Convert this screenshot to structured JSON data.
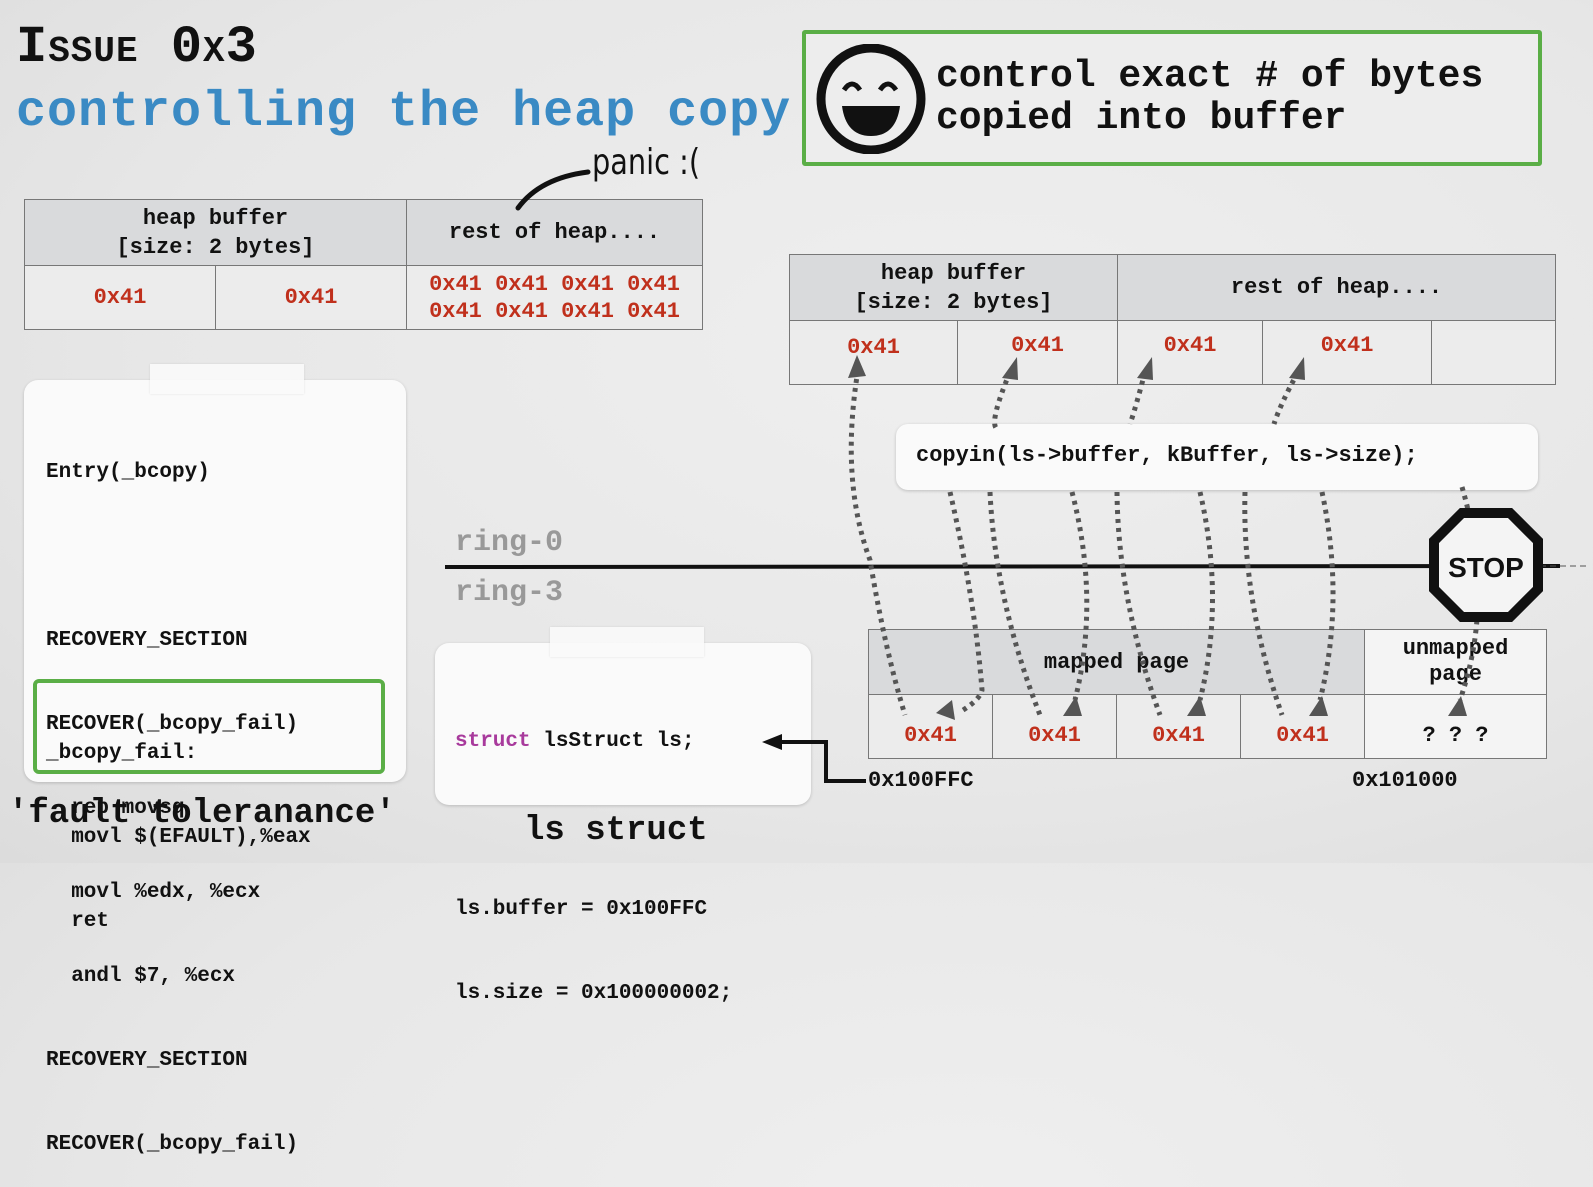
{
  "title": {
    "issue": "Issue 0x3",
    "subtitle": "controlling the heap copy"
  },
  "annotation": {
    "panic": "panic :("
  },
  "callout": {
    "icon": "smiley-face-icon",
    "line1": "control exact # of bytes",
    "line2": "copied into buffer",
    "border_color": "#5aae46"
  },
  "heap_table_left": {
    "header_buffer_line1": "heap buffer",
    "header_buffer_line2": "[size: 2 bytes]",
    "header_rest": "rest of heap....",
    "buffer_values": [
      "0x41",
      "0x41"
    ],
    "rest_values_row1": "0x41 0x41 0x41 0x41",
    "rest_values_row2": "0x41 0x41 0x41 0x41"
  },
  "heap_table_right": {
    "header_buffer_line1": "heap buffer",
    "header_buffer_line2": "[size: 2 bytes]",
    "header_rest": "rest of heap....",
    "values": [
      "0x41",
      "0x41",
      "0x41",
      "0x41",
      ""
    ]
  },
  "bcopy_card": {
    "lines": [
      "Entry(_bcopy)",
      "",
      "RECOVERY_SECTION",
      "RECOVER(_bcopy_fail)",
      "  rep movsq",
      "  movl %edx, %ecx",
      "  andl $7, %ecx",
      "RECOVERY_SECTION",
      "RECOVER(_bcopy_fail)"
    ],
    "fail_lines": [
      "_bcopy_fail:",
      "  movl $(EFAULT),%eax",
      "  ret"
    ],
    "caption": "'fault toleranance'"
  },
  "rings": {
    "ring0": "ring-0",
    "ring3": "ring-3"
  },
  "struct_card": {
    "keyword": "struct",
    "decl_rest": " lsStruct ls;",
    "line_buffer": "ls.buffer = 0x100FFC",
    "line_size": "ls.size = 0x100000002;",
    "caption": "ls struct"
  },
  "copyin_call": "copyin(ls->buffer, kBuffer, ls->size);",
  "stop_sign": {
    "label": "STOP",
    "icon": "stop-sign-icon"
  },
  "user_memory": {
    "mapped_label": "mapped page",
    "unmapped_label_line1": "unmapped",
    "unmapped_label_line2": "page",
    "values": [
      "0x41",
      "0x41",
      "0x41",
      "0x41"
    ],
    "unknown": "? ? ?",
    "addr_start": "0x100FFC",
    "addr_page": "0x101000"
  },
  "colors": {
    "title_blue": "#3a8ac4",
    "value_red": "#c0301c",
    "keyword_purple": "#a83a9c",
    "ring_gray": "#999999"
  }
}
